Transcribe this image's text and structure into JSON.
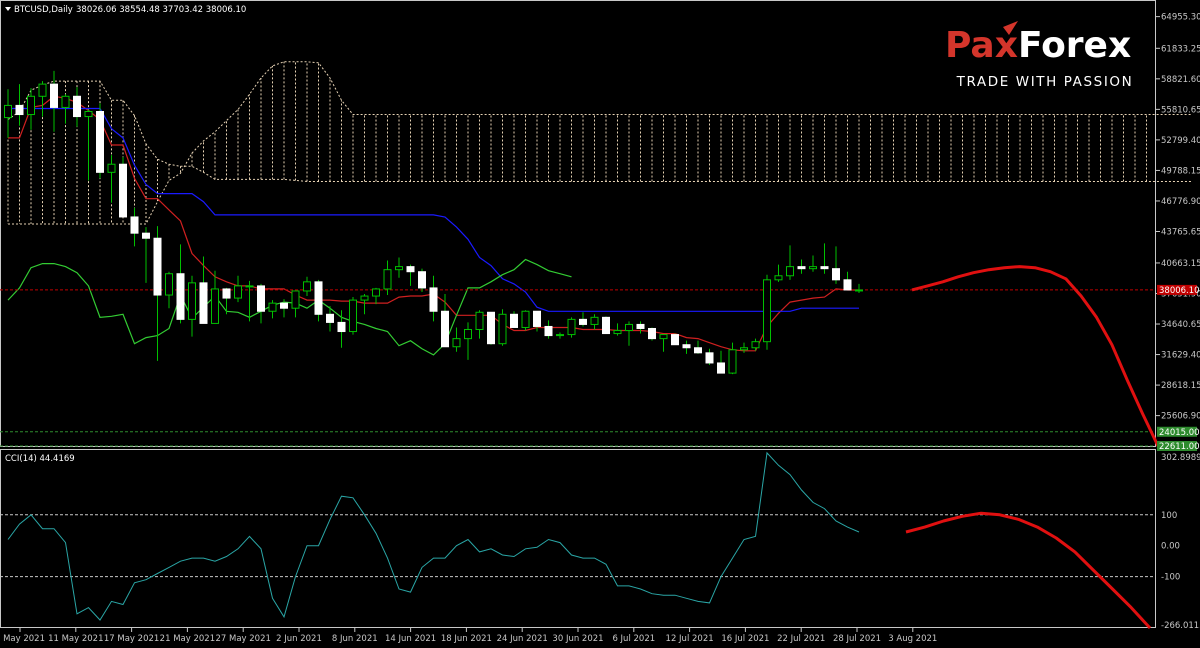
{
  "header": {
    "symbol": "BTCUSD,Daily",
    "ohlc": "38026.06 38554.48 37703.42 38006.10"
  },
  "brand": {
    "name_part1": "Pax",
    "name_part2": "Forex",
    "tagline": "TRADE WITH PASSION",
    "color_primary": "#d4352b",
    "color_secondary": "#ffffff"
  },
  "colors": {
    "bull_candle": "#ffffff",
    "bear_candle": "#ffffff",
    "wick": "#00c000",
    "tenkan": "#d02020",
    "kijun": "#1a1aff",
    "chikou": "#33cc33",
    "cloud": "#e6d2b4",
    "cci": "#2aa6a6",
    "forecast": "#e01010",
    "price_line": "#c00000"
  },
  "chart_data": [
    {
      "type": "candlestick",
      "title": "BTCUSD,Daily",
      "ylim": [
        22611,
        66300
      ],
      "y_ticks": [
        "64955.30",
        "61833.25",
        "58821.60",
        "55810.65",
        "52799.40",
        "49788.15",
        "46776.90",
        "43765.65",
        "40663.15",
        "37651.90",
        "34640.65",
        "31629.40",
        "28618.15",
        "25606.90",
        "22611.00"
      ],
      "current_price": 38006.1,
      "current_price_label": "38006.10",
      "extra_price_labels": [
        {
          "value": 24015.0,
          "label": "24015.00"
        },
        {
          "value": 22611.0,
          "label": "22611.00"
        }
      ],
      "x_labels": [
        "5 May 2021",
        "11 May 2021",
        "17 May 2021",
        "21 May 2021",
        "27 May 2021",
        "2 Jun 2021",
        "8 Jun 2021",
        "14 Jun 2021",
        "18 Jun 2021",
        "24 Jun 2021",
        "30 Jun 2021",
        "6 Jul 2021",
        "12 Jul 2021",
        "16 Jul 2021",
        "22 Jul 2021",
        "28 Jul 2021",
        "3 Aug 2021"
      ],
      "candles": [
        [
          55000,
          57800,
          53000,
          56200
        ],
        [
          56200,
          58300,
          54200,
          55300
        ],
        [
          55300,
          57900,
          53800,
          57100
        ],
        [
          57100,
          58600,
          55100,
          58300
        ],
        [
          58300,
          59600,
          53600,
          56000
        ],
        [
          56000,
          57300,
          54400,
          57100
        ],
        [
          57100,
          58000,
          54100,
          55100
        ],
        [
          55100,
          55800,
          48800,
          55600
        ],
        [
          55600,
          56400,
          49000,
          49600
        ],
        [
          49600,
          51300,
          46600,
          50400
        ],
        [
          50400,
          51100,
          45500,
          45200
        ],
        [
          45200,
          46100,
          42300,
          43600
        ],
        [
          43600,
          44200,
          38700,
          43100
        ],
        [
          43100,
          44300,
          31000,
          37500
        ],
        [
          37500,
          39800,
          36200,
          39600
        ],
        [
          39600,
          42500,
          34700,
          35100
        ],
        [
          35100,
          39400,
          33400,
          38700
        ],
        [
          38700,
          41300,
          34700,
          34700
        ],
        [
          34700,
          39900,
          34700,
          38100
        ],
        [
          38100,
          38200,
          35600,
          37200
        ],
        [
          37200,
          39400,
          36800,
          38400
        ],
        [
          38400,
          38900,
          34900,
          38400
        ],
        [
          38400,
          38600,
          34700,
          35900
        ],
        [
          35900,
          37000,
          35200,
          36700
        ],
        [
          36700,
          37100,
          35300,
          36200
        ],
        [
          36200,
          37900,
          35300,
          37900
        ],
        [
          37900,
          39300,
          37400,
          38800
        ],
        [
          38800,
          39000,
          34900,
          35600
        ],
        [
          35600,
          36400,
          33900,
          34800
        ],
        [
          34800,
          36000,
          32300,
          33900
        ],
        [
          33900,
          37300,
          33600,
          37000
        ],
        [
          37000,
          37600,
          35600,
          37400
        ],
        [
          37400,
          38200,
          36600,
          38100
        ],
        [
          38100,
          40900,
          37500,
          40000
        ],
        [
          40000,
          41200,
          39200,
          40300
        ],
        [
          40300,
          40500,
          38400,
          39800
        ],
        [
          39800,
          40100,
          37800,
          38200
        ],
        [
          38200,
          39400,
          34900,
          35900
        ],
        [
          35900,
          37600,
          32700,
          32400
        ],
        [
          32400,
          34300,
          31900,
          33200
        ],
        [
          33200,
          34800,
          31100,
          34100
        ],
        [
          34100,
          36000,
          33200,
          35800
        ],
        [
          35800,
          35800,
          32600,
          32700
        ],
        [
          32700,
          36100,
          32500,
          35600
        ],
        [
          35600,
          35900,
          34300,
          34300
        ],
        [
          34300,
          36000,
          34000,
          35900
        ],
        [
          35900,
          35200,
          33900,
          34400
        ],
        [
          34400,
          35000,
          33200,
          33500
        ],
        [
          33500,
          33800,
          33200,
          33600
        ],
        [
          33600,
          35300,
          33300,
          35100
        ],
        [
          35100,
          35800,
          34400,
          34600
        ],
        [
          34600,
          35600,
          34100,
          35300
        ],
        [
          35300,
          35400,
          33700,
          33700
        ],
        [
          33700,
          34700,
          33500,
          34000
        ],
        [
          34000,
          34900,
          32500,
          34600
        ],
        [
          34600,
          34900,
          33700,
          34200
        ],
        [
          34200,
          34300,
          33000,
          33200
        ],
        [
          33200,
          33600,
          31900,
          33600
        ],
        [
          33600,
          33700,
          32600,
          32600
        ],
        [
          32600,
          33000,
          31700,
          32300
        ],
        [
          32300,
          33000,
          31700,
          31800
        ],
        [
          31800,
          32200,
          30600,
          30800
        ],
        [
          30800,
          32000,
          29800,
          29800
        ],
        [
          29800,
          32800,
          29700,
          32100
        ],
        [
          32100,
          32800,
          31800,
          32300
        ],
        [
          32300,
          33200,
          32000,
          32900
        ],
        [
          32900,
          39500,
          32100,
          39000
        ],
        [
          39000,
          40500,
          38800,
          39400
        ],
        [
          39400,
          42400,
          39000,
          40300
        ],
        [
          40300,
          41000,
          39600,
          40100
        ],
        [
          40100,
          41400,
          39800,
          40300
        ],
        [
          40300,
          42600,
          39600,
          40100
        ],
        [
          40100,
          42300,
          38600,
          39000
        ],
        [
          39000,
          39800,
          38300,
          38000
        ],
        [
          38000,
          38600,
          37700,
          38000
        ]
      ],
      "series": [
        {
          "key": "tenkan",
          "values": [
            53000,
            53000,
            56000,
            56200,
            57100,
            56900,
            56500,
            55700,
            54800,
            52300,
            52300,
            49000,
            47000,
            47000,
            45900,
            44800,
            41600,
            40400,
            39300,
            38800,
            38400,
            38400,
            38100,
            38100,
            38100,
            37500,
            37000,
            37000,
            37000,
            36900,
            36900,
            36700,
            36700,
            36700,
            37300,
            37400,
            37400,
            37600,
            36800,
            35500,
            35500,
            35500,
            35500,
            34600,
            34000,
            34000,
            34300,
            34300,
            34300,
            34300,
            34100,
            34100,
            34100,
            34000,
            34000,
            34000,
            33900,
            33700,
            33700,
            33300,
            33200,
            32800,
            32400,
            32100,
            32000,
            32000,
            34400,
            35700,
            36800,
            37000,
            37200,
            37300,
            38100,
            38000,
            38000
          ]
        },
        {
          "key": "kijun",
          "values": [
            55900,
            55900,
            55900,
            55900,
            55900,
            55900,
            55900,
            55900,
            55900,
            53900,
            53000,
            50300,
            48400,
            47500,
            47500,
            47500,
            47500,
            46700,
            45400,
            45400,
            45400,
            45400,
            45400,
            45400,
            45400,
            45400,
            45400,
            45400,
            45400,
            45400,
            45400,
            45400,
            45400,
            45400,
            45400,
            45400,
            45400,
            45400,
            45200,
            44200,
            43000,
            41200,
            40400,
            39100,
            38600,
            37800,
            36300,
            35900,
            35900,
            35900,
            35900,
            35900,
            35900,
            35900,
            35900,
            35900,
            35900,
            35900,
            35900,
            35900,
            35900,
            35900,
            35900,
            35900,
            35900,
            35900,
            35900,
            35900,
            35900,
            36200,
            36200,
            36200,
            36200,
            36200,
            36200
          ]
        },
        {
          "key": "chikou",
          "values": [
            37000,
            38200,
            40200,
            40600,
            40600,
            40300,
            39700,
            38400,
            35300,
            35400,
            35600,
            32700,
            33300,
            33500,
            34200,
            37500,
            35200,
            36300,
            37400,
            35900,
            35800,
            35300,
            35900,
            36500,
            36800,
            36700,
            36200,
            37000,
            36200,
            35300,
            34900,
            34600,
            34200,
            33900,
            32500,
            33000,
            32200,
            31600,
            32700,
            35500,
            38200,
            38200,
            38800,
            39500,
            40000,
            41000,
            40500,
            39900,
            39600,
            39300
          ]
        }
      ],
      "cloud": {
        "span_a": [
          54800,
          55600,
          57700,
          58200,
          58600,
          58600,
          58600,
          58600,
          58600,
          56700,
          56700,
          55200,
          52400,
          50900,
          50400,
          50200,
          50200,
          49600,
          48900,
          48900,
          48900,
          48900,
          48900,
          48900,
          48900,
          48800,
          48700,
          48700,
          48700,
          48700,
          48700,
          48700,
          48700,
          48700,
          48700,
          48700,
          48700,
          48700,
          48700,
          48700,
          48700,
          48700,
          48700,
          48700,
          48700,
          48700,
          48700,
          48700,
          48700,
          48700,
          48700,
          48700,
          48700,
          48700,
          48700,
          48700,
          48700,
          48700,
          48700,
          48700,
          48700,
          48700,
          48700,
          48700,
          48700,
          48700,
          48700,
          48700,
          48700,
          48700,
          48700,
          48700,
          48700,
          48700,
          48700,
          48700,
          48700,
          48700,
          48700,
          48700,
          48700,
          48700,
          48700,
          48700,
          48700,
          48700,
          48700,
          48700,
          48700,
          48700,
          48700,
          48700,
          48700,
          48700,
          48700,
          48700,
          48700,
          48700,
          48700,
          48700,
          48700,
          48700,
          48700,
          48700
        ],
        "span_b": [
          44500,
          44500,
          44500,
          44500,
          44500,
          44500,
          44500,
          44500,
          44500,
          44500,
          44500,
          44500,
          44500,
          46700,
          48800,
          49500,
          51500,
          52700,
          53600,
          54700,
          55800,
          57300,
          58900,
          60100,
          60500,
          60500,
          60500,
          60400,
          58900,
          56700,
          55300,
          55300,
          55300,
          55300,
          55300,
          55300,
          55300,
          55300,
          55300,
          55300,
          55300,
          55300,
          55300,
          55300,
          55300,
          55300,
          55300,
          55300,
          55300,
          55300,
          55300,
          55300,
          55300,
          55300,
          55300,
          55300,
          55300,
          55300,
          55300,
          55300,
          55300,
          55300,
          55300,
          55300,
          55300,
          55300,
          55300,
          55300,
          55300,
          55300,
          55300,
          55300,
          55300,
          55300,
          55300,
          55300,
          55300,
          55300,
          55300,
          55300,
          55300,
          55300,
          55300,
          55300,
          55300,
          55300,
          55300,
          55300,
          55300,
          55300,
          55300,
          55300,
          55300,
          55300,
          55300,
          55300,
          55300,
          55300,
          55300,
          55300,
          55300,
          55300,
          55300,
          55300
        ]
      },
      "forecast": [
        [
          38006,
          38400,
          38800,
          39300,
          39700,
          40000,
          40200,
          40300,
          40200,
          39800,
          39100,
          37400,
          35300,
          32600,
          29100,
          25800,
          22611
        ]
      ]
    },
    {
      "type": "line",
      "title": "CCI(14) 44.4169",
      "ylim": [
        -266.0113,
        302.8989
      ],
      "y_ticks": [
        "302.8989",
        "100",
        "0.00",
        "-100",
        "-266.0113"
      ],
      "levels": [
        100,
        -100
      ],
      "series": [
        {
          "key": "cci",
          "values": [
            20,
            70,
            100,
            55,
            55,
            10,
            -220,
            -200,
            -240,
            -180,
            -190,
            -120,
            -110,
            -90,
            -70,
            -50,
            -40,
            -40,
            -50,
            -35,
            -10,
            30,
            -10,
            -170,
            -230,
            -100,
            0,
            0,
            85,
            160,
            155,
            100,
            40,
            -40,
            -140,
            -150,
            -70,
            -40,
            -40,
            0,
            20,
            -20,
            -10,
            -30,
            -35,
            -10,
            -5,
            20,
            10,
            -30,
            -40,
            -40,
            -60,
            -130,
            -130,
            -140,
            -155,
            -160,
            -160,
            -170,
            -180,
            -185,
            -100,
            -40,
            20,
            30,
            300,
            260,
            230,
            180,
            140,
            120,
            80,
            60,
            44.4169
          ]
        },
        {
          "key": "forecast",
          "values": [
            44.4,
            60,
            80,
            95,
            105,
            100,
            85,
            60,
            25,
            -20,
            -80,
            -140,
            -200,
            -266
          ]
        }
      ]
    }
  ]
}
